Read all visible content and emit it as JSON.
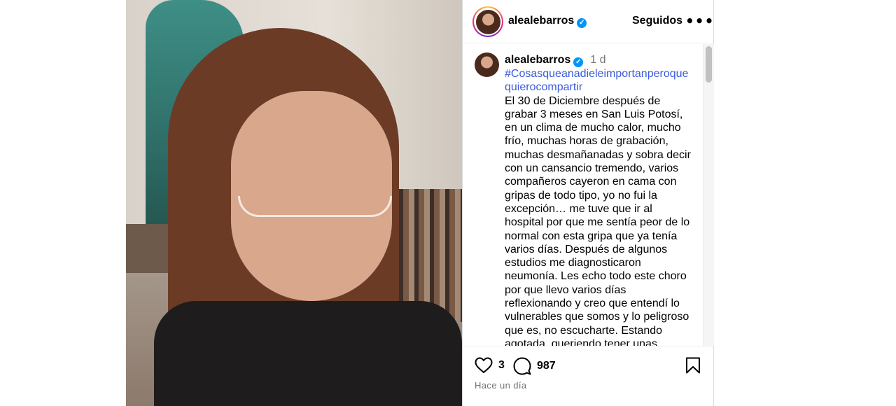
{
  "post": {
    "username": "alealebarros",
    "verified_icon": "verified-badge-icon",
    "follow_label": "Seguidos",
    "more_label": "•••"
  },
  "caption": {
    "username": "alealebarros",
    "time": "1 d",
    "hashtag": "#Cosasqueanadieleimportanperoquequierocompartir",
    "text": "El 30 de Diciembre después de grabar 3 meses en San Luis Potosí, en un clima de mucho calor, mucho frío, muchas horas de grabación, muchas desmañanadas y sobra decir con un cansancio tremendo, varios compañeros cayeron en cama con gripas de todo tipo, yo no fui la excepción… me tuve que ir al hospital por que me sentía peor de lo normal con esta gripa que ya tenía varios días. Después de algunos estudios me diagnosticaron neumonía. Les echo todo este choro por que llevo varios días reflexionando y creo que entendí lo vulnerables que somos y lo peligroso que es, no escucharte. Estando agotada, queriendo tener unas vacaciones en familia y con"
  },
  "footer": {
    "likes": "3",
    "comments": "987",
    "posted": "Hace un día"
  },
  "colors": {
    "accent": "#0095f6",
    "hashtag": "#3b5bd9",
    "muted": "#737373"
  }
}
